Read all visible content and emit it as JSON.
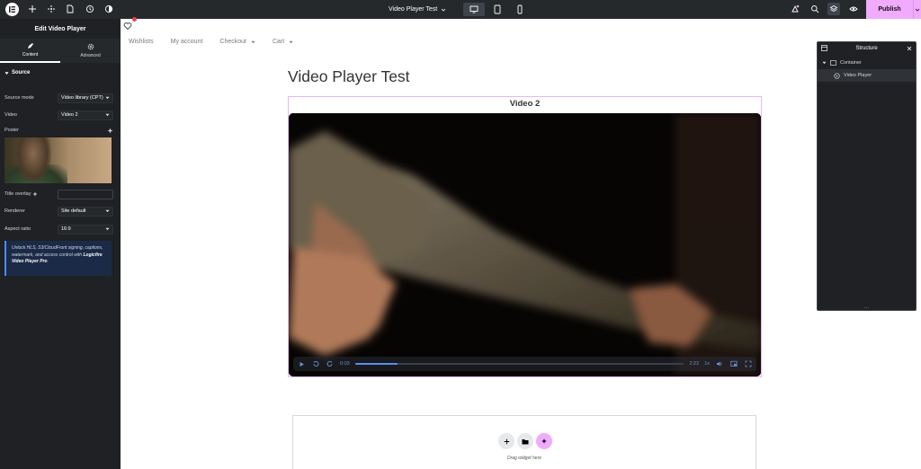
{
  "topbar": {
    "doc_title": "Video Player Test",
    "publish_label": "Publish"
  },
  "panel": {
    "title": "Edit Video Player",
    "tabs": [
      {
        "label": "Content",
        "icon": "pencil-icon"
      },
      {
        "label": "Advanced",
        "icon": "gear-icon"
      }
    ],
    "section_title": "Source",
    "fields": {
      "source_mode": {
        "label": "Source mode",
        "value": "Video library (CPT)"
      },
      "video": {
        "label": "Video",
        "value": "Video 2"
      },
      "poster": {
        "label": "Poster"
      },
      "title_overlay": {
        "label": "Title overlay",
        "value": ""
      },
      "renderer": {
        "label": "Renderer",
        "value": "Site default"
      },
      "aspect_ratio": {
        "label": "Aspect ratio",
        "value": "16:9"
      }
    },
    "promo": {
      "text": "Unlock HLS, S3/CloudFront signing, captions, watermark, and access control with ",
      "product": "Logicfire Video Player Pro",
      "suffix": "."
    }
  },
  "canvas": {
    "nav": [
      "Wishlists",
      "My account",
      "Checkout",
      "Cart"
    ],
    "page_title": "Video Player Test",
    "video_title": "Video 2",
    "player": {
      "current_time": "0:03",
      "duration": "2:22",
      "speed": "1x",
      "progress_fraction": 0.13
    },
    "dropzone_label": "Drag widget here"
  },
  "structure": {
    "title": "Structure",
    "items": [
      {
        "label": "Container"
      },
      {
        "label": "Video Player"
      }
    ],
    "footer": "..."
  },
  "colors": {
    "accent_pink": "#f0abfc",
    "panel_bg": "#1f2124",
    "topbar_bg": "#26292c",
    "player_blue": "#5b8def"
  }
}
